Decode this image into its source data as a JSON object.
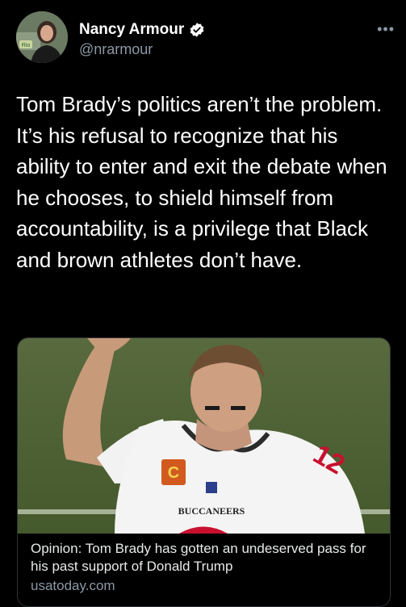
{
  "author": {
    "display_name": "Nancy Armour",
    "handle": "@nrarmour",
    "verified": true,
    "avatar_badge": "Rio"
  },
  "menu_icon": "more-dots-icon",
  "tweet": {
    "text": "Tom Brady’s politics aren’t the problem. It’s his refusal to recognize that his ability to enter and exit the debate when he chooses, to shield himself from accountability, is a privilege that Black and brown athletes don’t have."
  },
  "link_card": {
    "image_alt": "Tom Brady in Buccaneers jersey raising his hand",
    "jersey_text": "BUCCANEERS",
    "jersey_number": "12",
    "captain_patch": "C",
    "title": "Opinion: Tom Brady has gotten an undeserved pass for his past support of Donald Trump",
    "domain": "usatoday.com"
  },
  "colors": {
    "background": "#000000",
    "text": "#ffffff",
    "secondary": "#8b98a5",
    "verified": "#ffffff"
  }
}
